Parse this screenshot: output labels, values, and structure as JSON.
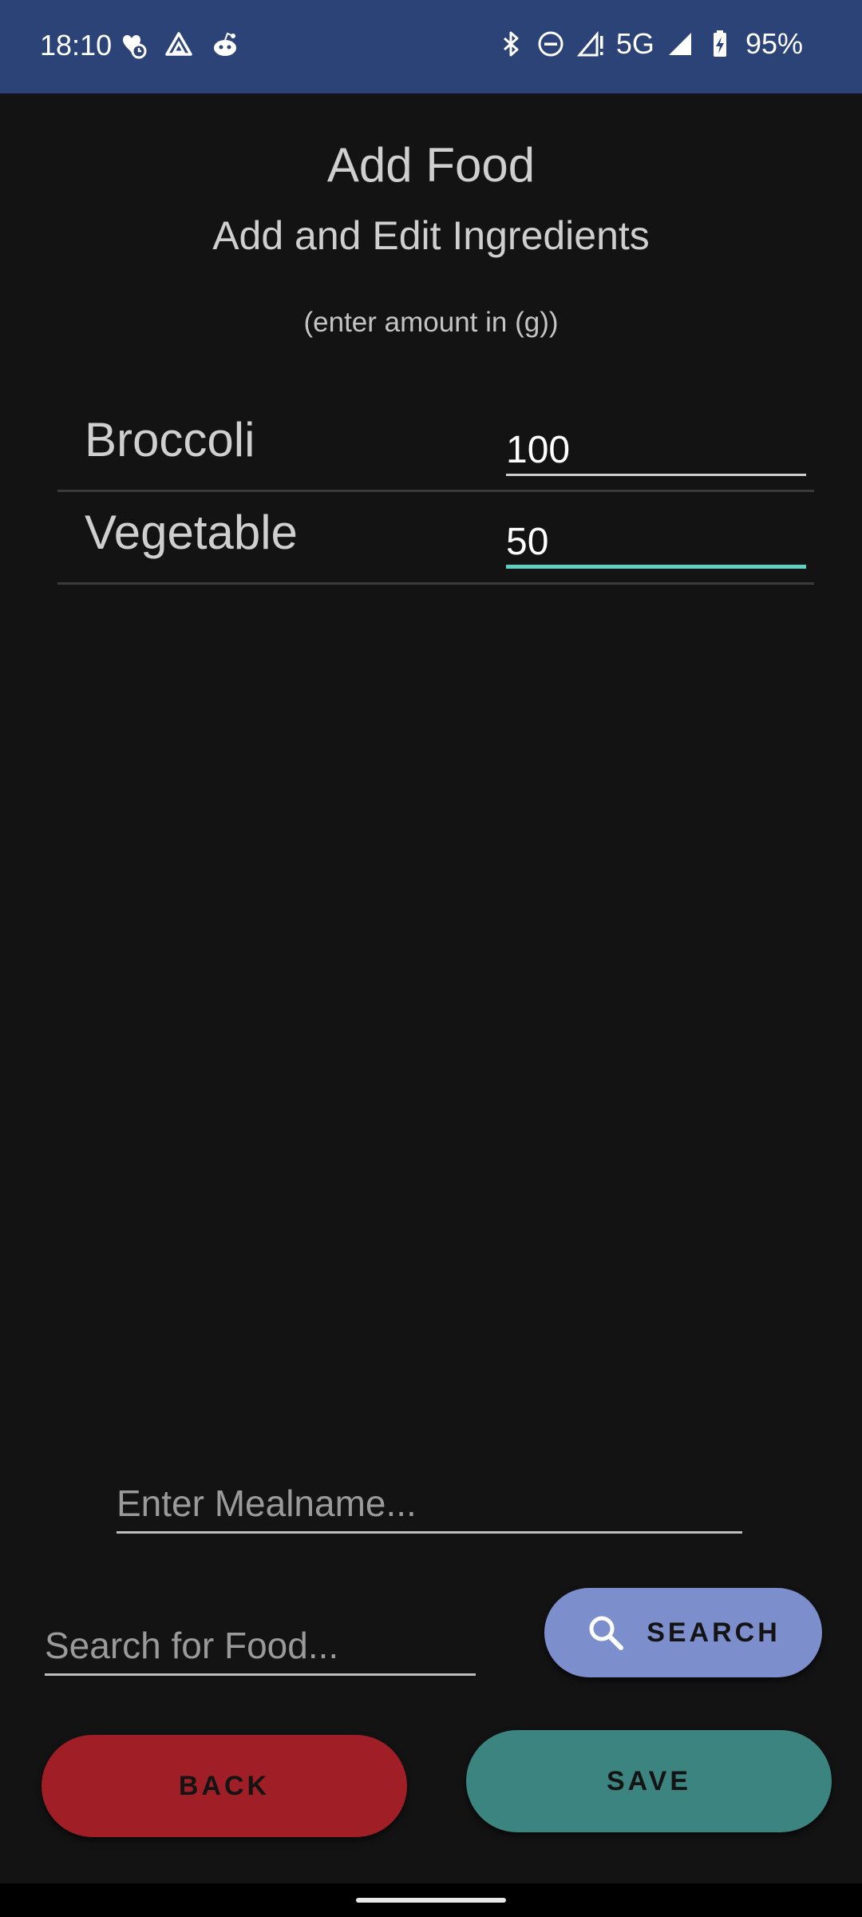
{
  "status_bar": {
    "time": "18:10",
    "network": "5G",
    "battery": "95%",
    "left_icons": [
      "health-alarm-icon",
      "drive-icon",
      "reddit-icon"
    ],
    "right_icons": [
      "bluetooth-icon",
      "do-not-disturb-icon",
      "signal-alert-icon",
      "signal-icon",
      "battery-charging-icon"
    ]
  },
  "header": {
    "title": "Add Food",
    "subtitle": "Add and Edit Ingredients",
    "hint": "(enter amount in (g))"
  },
  "ingredients": [
    {
      "name": "Broccoli",
      "amount": "100"
    },
    {
      "name": "Vegetable",
      "amount": "50"
    }
  ],
  "meal_name": {
    "value": "",
    "placeholder": "Enter Mealname..."
  },
  "food_search": {
    "value": "",
    "placeholder": "Search for Food...",
    "button_label": "SEARCH"
  },
  "actions": {
    "back_label": "BACK",
    "save_label": "SAVE"
  },
  "colors": {
    "status_bar": "#2c4378",
    "background": "#131313",
    "focus_accent": "#5fd0c0",
    "search_button": "#7c8fcc",
    "back_button": "#a01f27",
    "save_button": "#3b8480"
  }
}
